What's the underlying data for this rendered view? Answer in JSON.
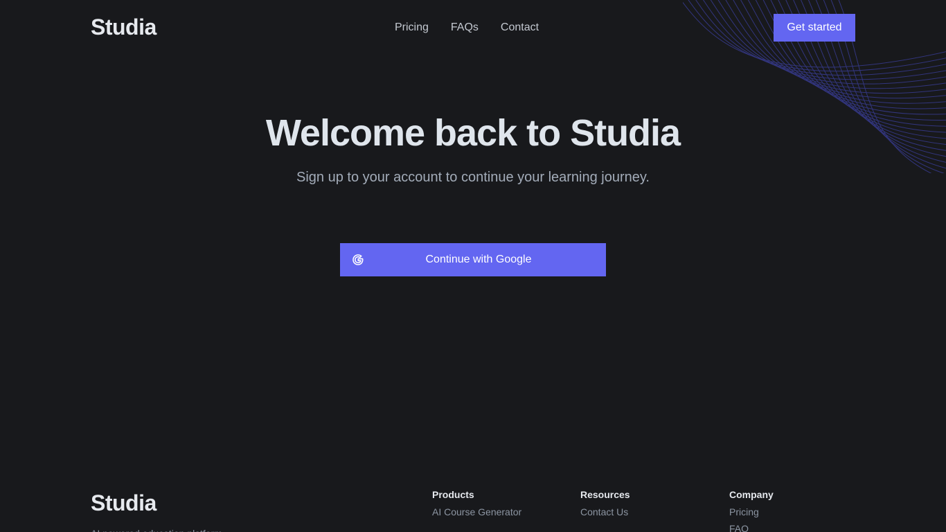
{
  "nav": {
    "logo": "Studia",
    "links": [
      "Pricing",
      "FAQs",
      "Contact"
    ],
    "cta_label": "Get started"
  },
  "hero": {
    "title": "Welcome back to Studia",
    "subtitle": "Sign up to your account to continue your learning journey."
  },
  "auth": {
    "google_label": "Continue with Google",
    "google_icon": "google-g-icon"
  },
  "footer": {
    "logo": "Studia",
    "tagline": "AI powered education platform",
    "columns": [
      {
        "heading": "Products",
        "links": [
          "AI Course Generator"
        ]
      },
      {
        "heading": "Resources",
        "links": [
          "Contact Us"
        ]
      },
      {
        "heading": "Company",
        "links": [
          "Pricing",
          "FAQ"
        ]
      }
    ]
  },
  "colors": {
    "background": "#18191c",
    "accent": "#6366f1",
    "heading": "#dfe5ec",
    "muted": "#a3acb9"
  }
}
